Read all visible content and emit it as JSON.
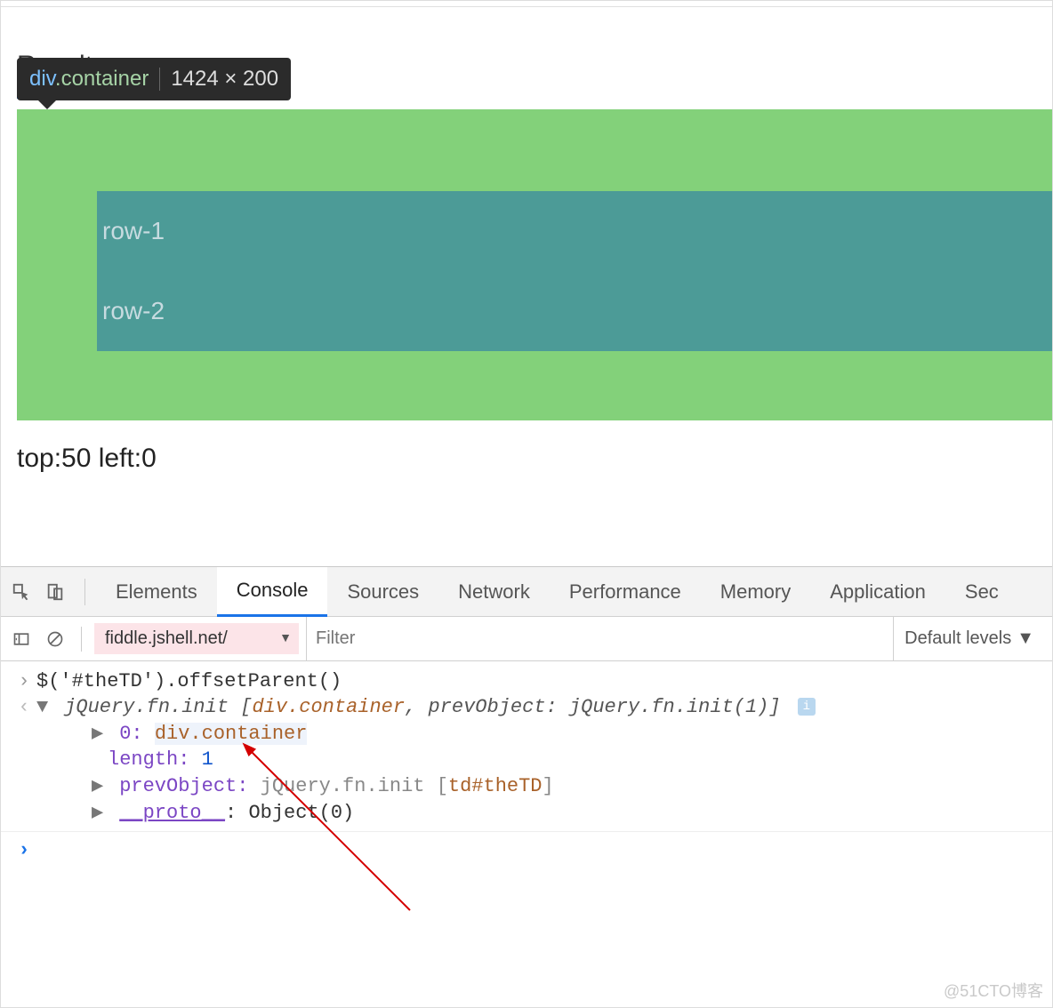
{
  "result_tab_label": "Result",
  "tooltip": {
    "tag": "div",
    "class": ".container",
    "dims": "1424 × 200"
  },
  "preview": {
    "rows": [
      "row-1",
      "row-2"
    ],
    "offset_text": "top:50 left:0"
  },
  "devtools": {
    "tabs": [
      "Elements",
      "Console",
      "Sources",
      "Network",
      "Performance",
      "Memory",
      "Application",
      "Sec"
    ],
    "active_tab": "Console",
    "toolbar": {
      "context": "fiddle.jshell.net/",
      "filter_placeholder": "Filter",
      "levels_label": "Default levels"
    },
    "log": {
      "input": "$('#theTD').offsetParent()",
      "output_head_prefix": "jQuery.fn.init",
      "output_head_bracket_open": " [",
      "output_head_item": "div.container",
      "output_head_sep": ",",
      "output_head_prev_key": " prevObject:",
      "output_head_prev_val": " jQuery.fn.init(1)",
      "output_head_bracket_close": "]",
      "row0_key": "0: ",
      "row0_val": "div.container",
      "length_key": "length: ",
      "length_val": "1",
      "prev_key": "prevObject: ",
      "prev_val_prefix": "jQuery.fn.init ",
      "prev_val_bracket": "[",
      "prev_val_item": "td#theTD",
      "prev_val_close": "]",
      "proto_key": "__proto__",
      "proto_sep": ": ",
      "proto_val": "Object(0)"
    }
  },
  "watermark": "@51CTO博客"
}
